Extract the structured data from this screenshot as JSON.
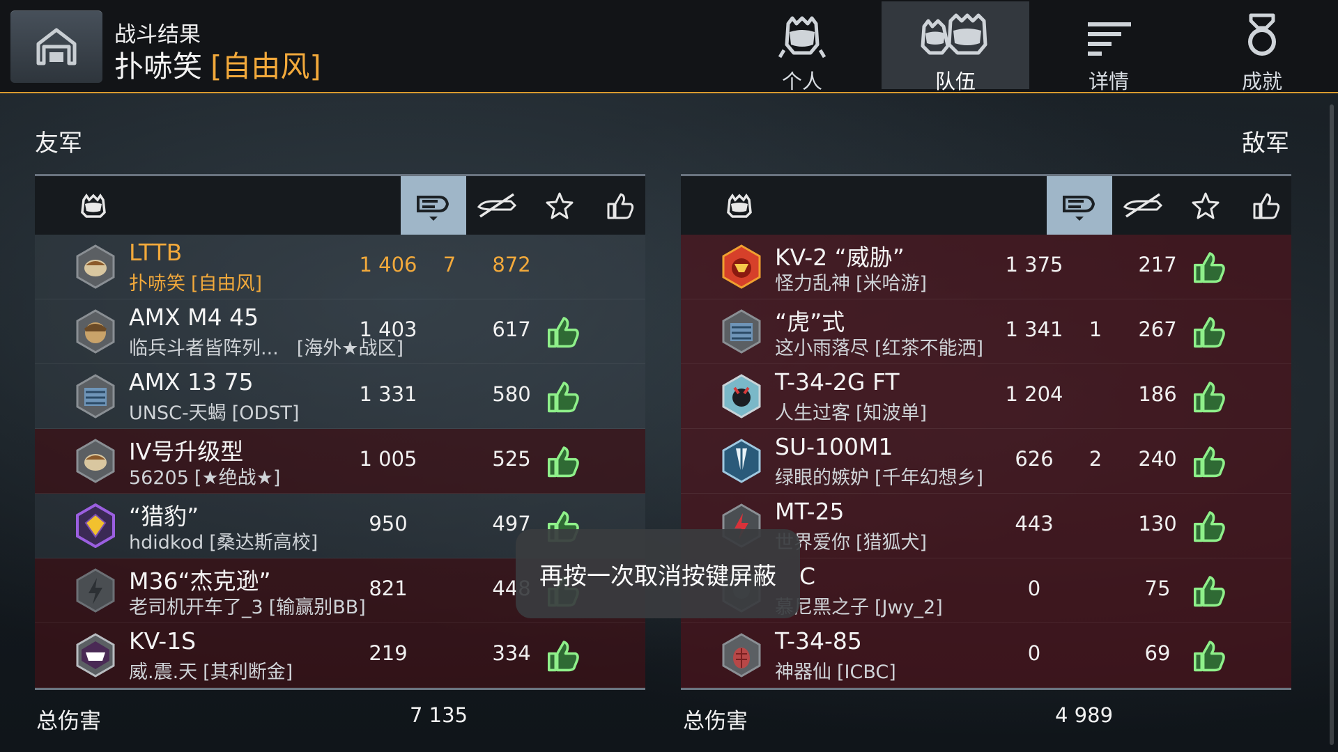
{
  "header": {
    "caption": "战斗结果",
    "player": "扑哧笑",
    "clan": "[自由风]"
  },
  "tabs": [
    {
      "label": "个人",
      "icon": "personal-icon"
    },
    {
      "label": "队伍",
      "icon": "team-icon",
      "active": true
    },
    {
      "label": "详情",
      "icon": "details-icon"
    },
    {
      "label": "成就",
      "icon": "achievements-icon"
    }
  ],
  "allies": {
    "title": "友军",
    "rows": [
      {
        "tank": "LTTB",
        "player": "扑哧笑",
        "clan": "[自由风]",
        "damage": "1 406",
        "kills": "7",
        "xp": "872",
        "liked": false,
        "me": true
      },
      {
        "tank": "AMX M4 45",
        "player": "临兵斗者皆阵列...",
        "clan": "[海外★战区]",
        "damage": "1 403",
        "kills": "",
        "xp": "617",
        "liked": true
      },
      {
        "tank": "AMX 13 75",
        "player": "UNSC-天蝎",
        "clan": "[ODST]",
        "damage": "1 331",
        "kills": "",
        "xp": "580",
        "liked": true
      },
      {
        "tank": "IV号升级型",
        "player": "56205",
        "clan": "[★绝战★]",
        "damage": "1 005",
        "kills": "",
        "xp": "525",
        "liked": true
      },
      {
        "tank": "“猎豹”",
        "player": "hdidkod",
        "clan": "[桑达斯高校]",
        "damage": "950",
        "kills": "",
        "xp": "497",
        "liked": true
      },
      {
        "tank": "M36“杰克逊”",
        "player": "老司机开车了_3",
        "clan": "[输赢别BB]",
        "damage": "821",
        "kills": "",
        "xp": "448",
        "liked": true
      },
      {
        "tank": "KV-1S",
        "player": "威.震.天",
        "clan": "[其利断金]",
        "damage": "219",
        "kills": "",
        "xp": "334",
        "liked": true
      }
    ],
    "total_label": "总伤害",
    "total": "7 135"
  },
  "enemies": {
    "title": "敌军",
    "rows": [
      {
        "tank": "KV-2 “威胁”",
        "player": "怪力乱神",
        "clan": "[米哈游]",
        "damage": "1 375",
        "kills": "",
        "xp": "217",
        "liked": true
      },
      {
        "tank": "“虎”式",
        "player": "这小雨落尽",
        "clan": "[红茶不能洒]",
        "damage": "1 341",
        "kills": "1",
        "xp": "267",
        "liked": true
      },
      {
        "tank": "T-34-2G FT",
        "player": "人生过客",
        "clan": "[知波单]",
        "damage": "1 204",
        "kills": "",
        "xp": "186",
        "liked": true
      },
      {
        "tank": "SU-100M1",
        "player": "绿眼的嫉妒",
        "clan": "[千年幻想乡]",
        "damage": "626",
        "kills": "2",
        "xp": "240",
        "liked": true
      },
      {
        "tank": "MT-25",
        "player": "世界爱你",
        "clan": "[猎狐犬]",
        "damage": "443",
        "kills": "",
        "xp": "130",
        "liked": true
      },
      {
        "tank": "C",
        "player": "慕尼黑之子",
        "clan": "[Jwy_2]",
        "damage": "0",
        "kills": "",
        "xp": "75",
        "liked": true
      },
      {
        "tank": "T-34-85",
        "player": "神器仙",
        "clan": "[ICBC]",
        "damage": "0",
        "kills": "",
        "xp": "69",
        "liked": true
      }
    ],
    "total_label": "总伤害",
    "total": "4 989"
  },
  "toast": "再按一次取消按键屏蔽",
  "colors": {
    "accent": "#f2a93b",
    "like_green": "#7fe07a",
    "sort_active": "#9fb6c8",
    "enemy_row": "#4b141c"
  }
}
